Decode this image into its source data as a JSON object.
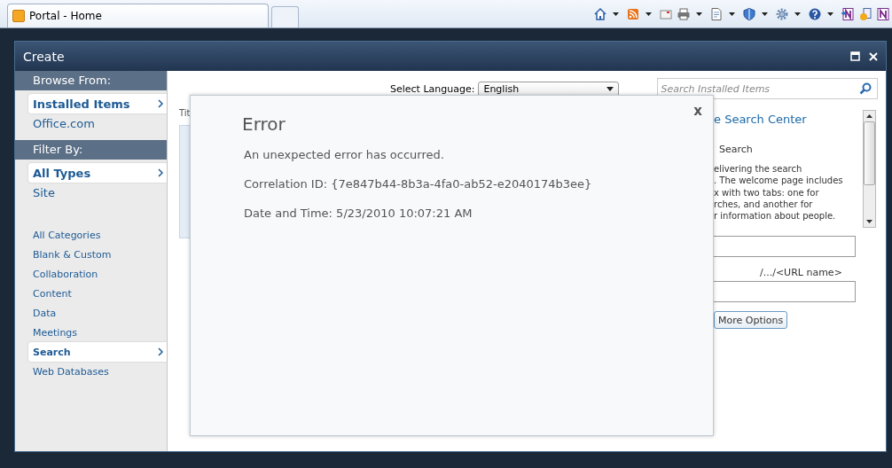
{
  "browser": {
    "tab_title": "Portal - Home"
  },
  "dialog": {
    "title": "Create"
  },
  "sidebar": {
    "sections": [
      {
        "heading": "Browse From:",
        "groups": [
          [
            {
              "label": "Installed Items",
              "selected": true
            },
            {
              "label": "Office.com",
              "selected": false
            }
          ]
        ]
      },
      {
        "heading": "Filter By:",
        "groups": [
          [
            {
              "label": "All Types",
              "selected": true
            },
            {
              "label": "Site",
              "selected": false
            }
          ],
          [
            {
              "label": "All Categories",
              "selected": false
            },
            {
              "label": "Blank & Custom",
              "selected": false
            },
            {
              "label": "Collaboration",
              "selected": false
            },
            {
              "label": "Content",
              "selected": false
            },
            {
              "label": "Data",
              "selected": false
            },
            {
              "label": "Meetings",
              "selected": false
            },
            {
              "label": "Search",
              "selected": true
            },
            {
              "label": "Web Databases",
              "selected": false
            }
          ]
        ]
      }
    ]
  },
  "content": {
    "language": {
      "label": "Select Language:",
      "value": "English"
    },
    "search": {
      "placeholder": "Search Installed Items"
    },
    "column_1": "Tit",
    "details": {
      "title": "e Search Center",
      "subtitle": "Search",
      "description_lines": [
        "elivering the search",
        ". The welcome page includes",
        "x with two tabs: one for",
        "rches, and another for",
        "r information about people."
      ],
      "url_hint": "/.../<URL name>",
      "button": "More Options"
    }
  },
  "error": {
    "title": "Error",
    "close": "x",
    "lines": [
      "An unexpected error has occurred.",
      "Correlation ID: {7e847b44-8b3a-4fa0-ab52-e2040174b3ee}",
      "Date and Time: 5/23/2010 10:07:21 AM"
    ]
  }
}
